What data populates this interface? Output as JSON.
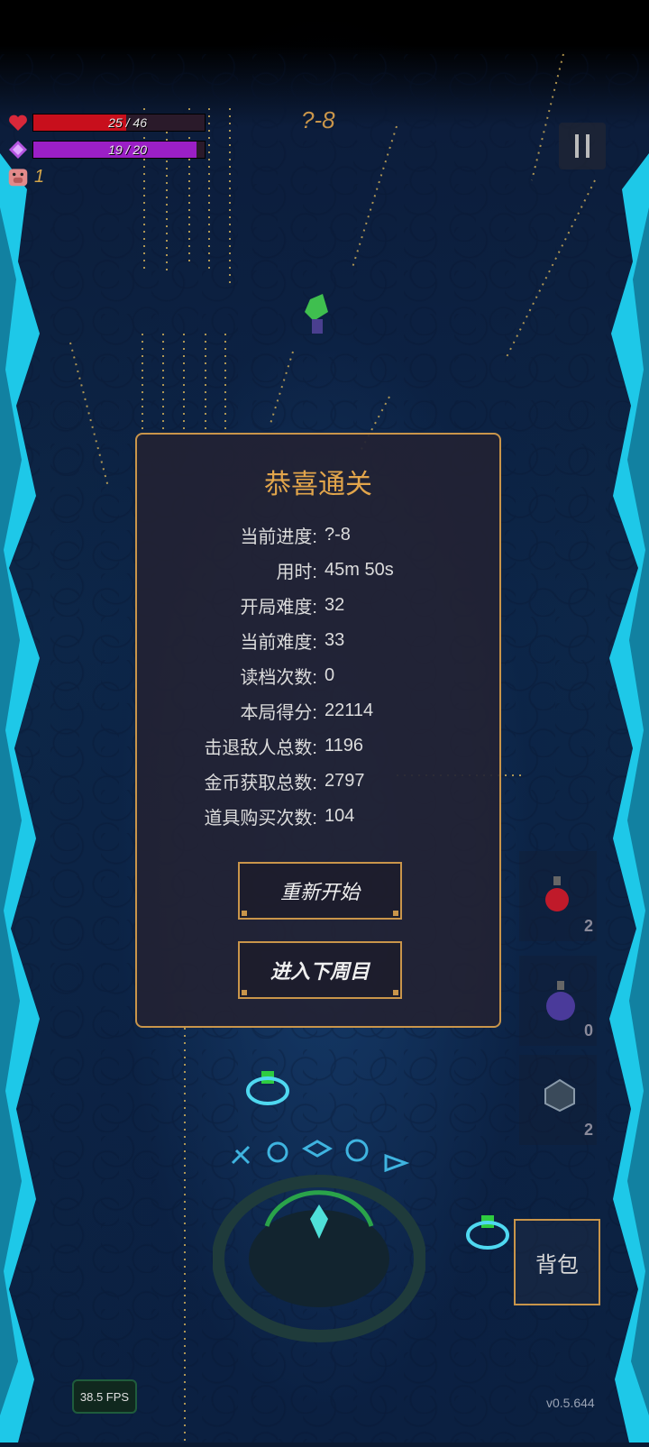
{
  "hud": {
    "hp": {
      "current": 25,
      "max": 46,
      "text": "25 / 46"
    },
    "mp": {
      "current": 19,
      "max": 20,
      "text": "19 / 20"
    },
    "pig_count": "1",
    "stage": "?-8"
  },
  "modal": {
    "title": "恭喜通关",
    "stats": [
      {
        "label": "当前进度:",
        "value": "?-8"
      },
      {
        "label": "用时:",
        "value": "45m 50s"
      },
      {
        "label": "开局难度:",
        "value": "32"
      },
      {
        "label": "当前难度:",
        "value": "33"
      },
      {
        "label": "读档次数:",
        "value": "0"
      },
      {
        "label": "本局得分:",
        "value": "22114"
      },
      {
        "label": "击退敌人总数:",
        "value": "1196"
      },
      {
        "label": "金币获取总数:",
        "value": "2797"
      },
      {
        "label": "道具购买次数:",
        "value": "104"
      }
    ],
    "restart_label": "重新开始",
    "next_label": "进入下周目"
  },
  "items": [
    {
      "icon": "red-potion-icon",
      "count": "2"
    },
    {
      "icon": "purple-potion-icon",
      "count": "0"
    },
    {
      "icon": "dice-icon",
      "count": "2"
    }
  ],
  "bag_label": "背包",
  "fps": "38.5 FPS",
  "version": "v0.5.644",
  "colors": {
    "accent": "#c9954a",
    "title": "#e2a54b",
    "hp": "#c80f1c",
    "mp": "#9b1fc6",
    "crystal": "#1ec8e8"
  }
}
